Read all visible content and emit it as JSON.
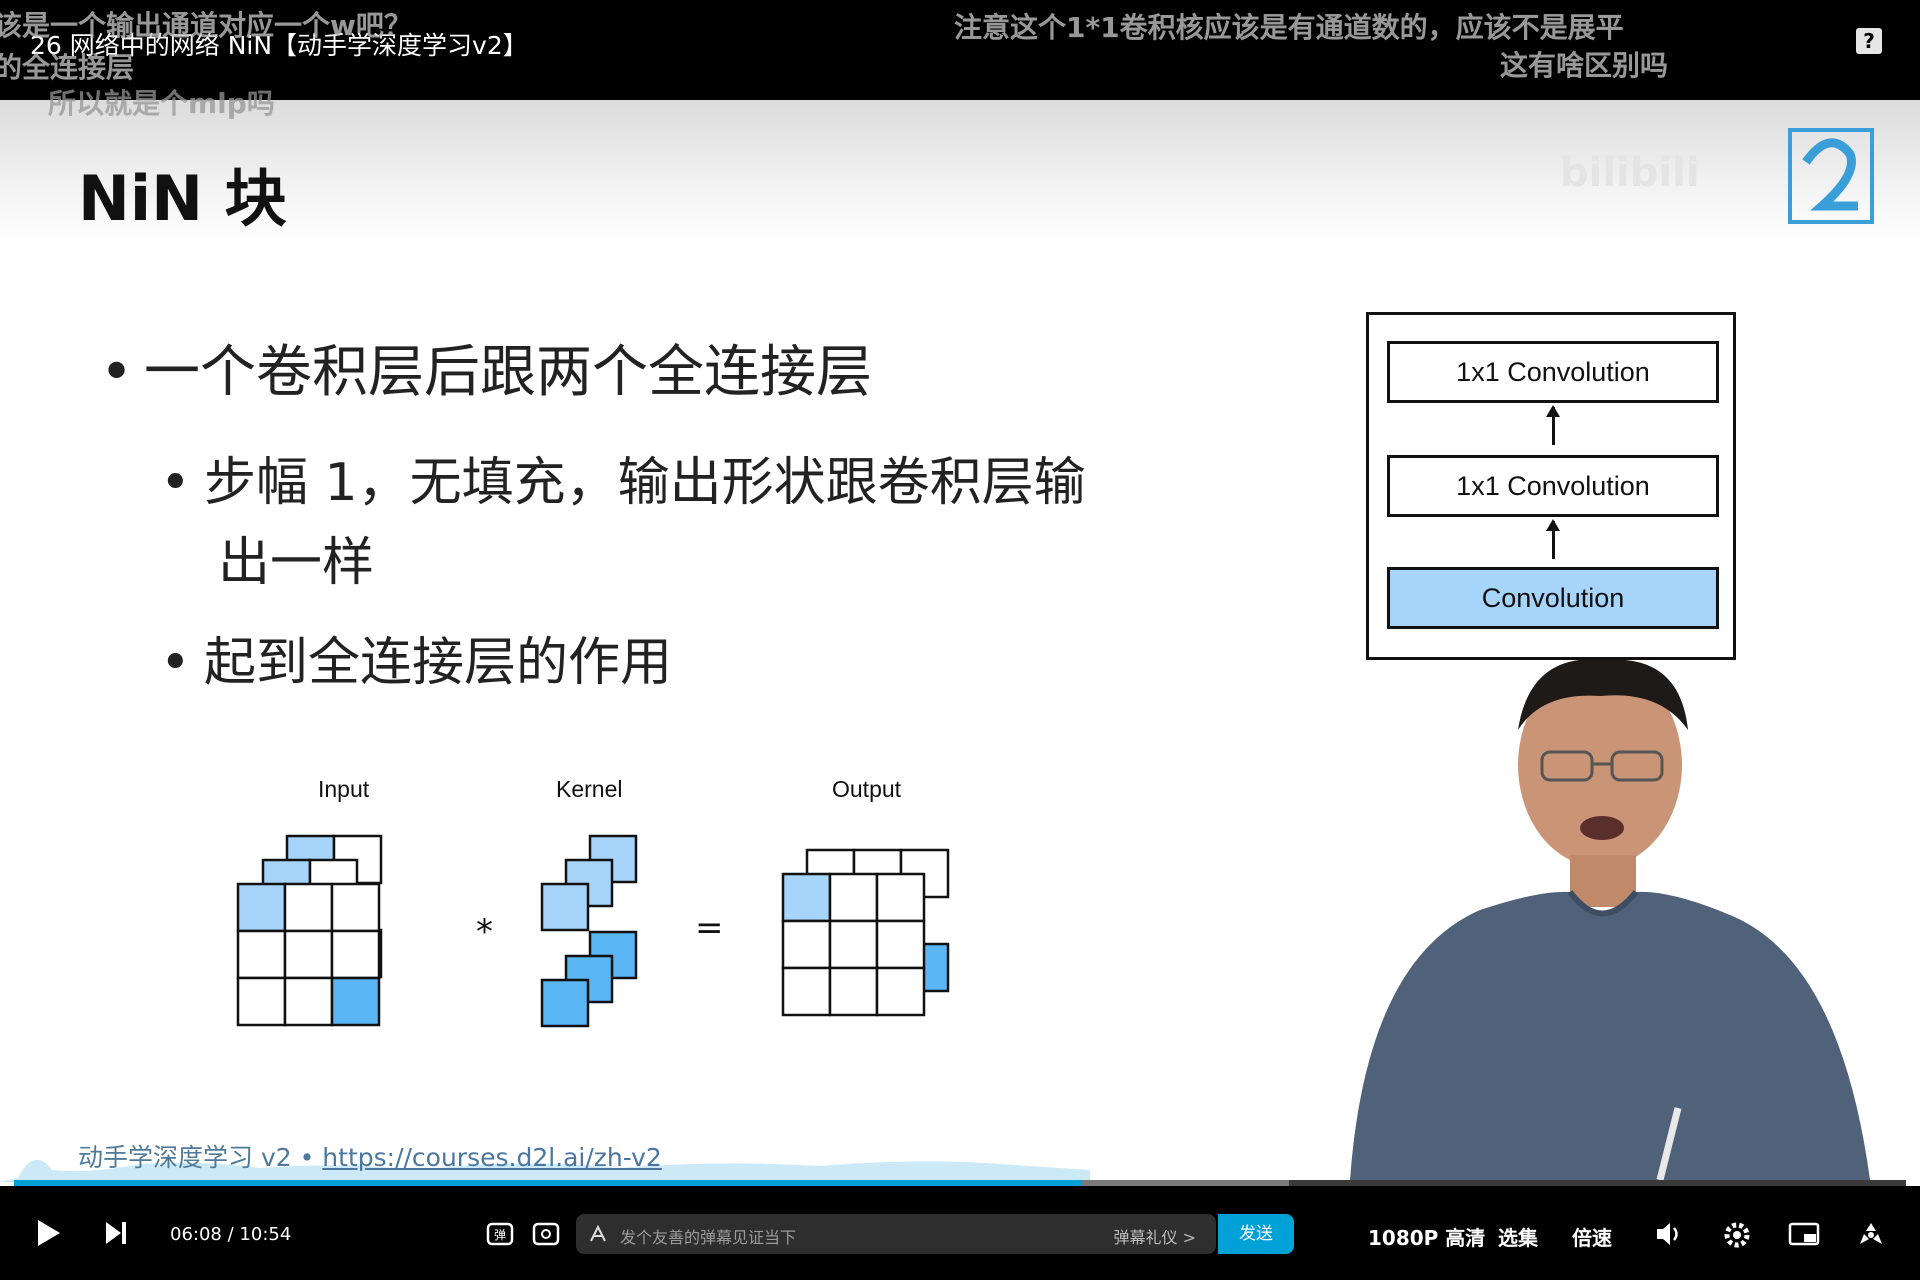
{
  "window": {
    "video_title": "26 网络中的网络 NiN【动手学深度学习v2】",
    "help_label": "?"
  },
  "danmaku": [
    "该是一个输出通道对应一个w吧？",
    "的全连接层",
    "所以就是个mlp吗",
    "注意这个1*1卷积核应该是有通道数的，应该不是展平",
    "这有啥区别吗"
  ],
  "slide": {
    "title": "NiN 块",
    "bullets": [
      "一个卷积层后跟两个全连接层",
      "步幅 1，无填充，输出形状跟卷积层输",
      "出一样",
      "起到全连接层的作用"
    ],
    "diagram": {
      "layers": [
        "1x1 Convolution",
        "1x1 Convolution",
        "Convolution"
      ]
    },
    "conv_figure": {
      "labels": [
        "Input",
        "Kernel",
        "Output"
      ],
      "operators": [
        "*",
        "="
      ]
    },
    "footer_prefix": "动手学深度学习 v2 • ",
    "footer_link": "https://courses.d2l.ai/zh-v2"
  },
  "player": {
    "current_time": "06:08",
    "separator": "/",
    "duration": "10:54",
    "progress": 0.564,
    "buffered": 0.674,
    "danmaku_placeholder": "发个友善的弹幕见证当下",
    "danmaku_etiquette": "弹幕礼仪 >",
    "send_label": "发送",
    "quality_label": "1080P 高清",
    "episodes_label": "选集",
    "speed_label": "倍速",
    "accent_color": "#00a1d6"
  }
}
